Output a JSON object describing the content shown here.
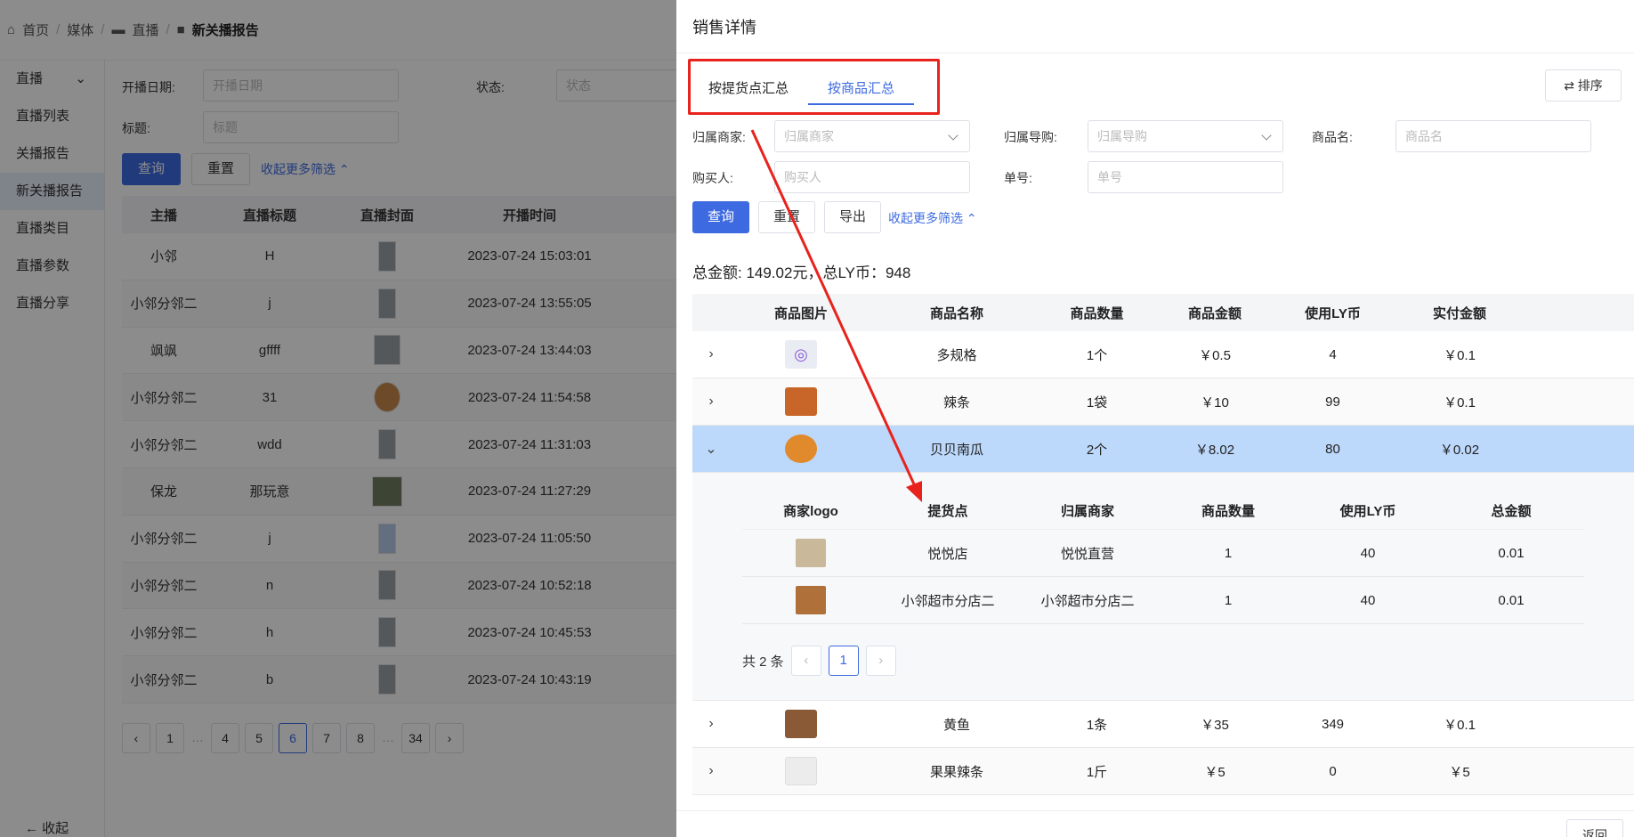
{
  "breadcrumb": {
    "home": "首页",
    "media": "媒体",
    "live": "直播",
    "current": "新关播报告",
    "sep": "/"
  },
  "sidebar": {
    "group": "直播",
    "items": [
      "直播列表",
      "关播报告",
      "新关播报告",
      "直播类目",
      "直播参数",
      "直播分享"
    ],
    "collapse": "收起"
  },
  "bg_filter": {
    "date_label": "开播日期:",
    "date_placeholder": "开播日期",
    "status_label": "状态:",
    "status_placeholder": "状态",
    "title_label": "标题:",
    "title_placeholder": "标题",
    "query": "查询",
    "reset": "重置",
    "fold": "收起更多筛选"
  },
  "bg_table": {
    "headers": [
      "主播",
      "直播标题",
      "直播封面",
      "开播时间"
    ],
    "rows": [
      {
        "host": "小邻",
        "title": "H",
        "time": "2023-07-24 15:03:01"
      },
      {
        "host": "小邻分邻二",
        "title": "j",
        "time": "2023-07-24 13:55:05"
      },
      {
        "host": "飒飒",
        "title": "gffff",
        "time": "2023-07-24 13:44:03"
      },
      {
        "host": "小邻分邻二",
        "title": "31",
        "time": "2023-07-24 11:54:58"
      },
      {
        "host": "小邻分邻二",
        "title": "wdd",
        "time": "2023-07-24 11:31:03"
      },
      {
        "host": "保龙",
        "title": "那玩意",
        "time": "2023-07-24 11:27:29"
      },
      {
        "host": "小邻分邻二",
        "title": "j",
        "time": "2023-07-24 11:05:50"
      },
      {
        "host": "小邻分邻二",
        "title": "n",
        "time": "2023-07-24 10:52:18"
      },
      {
        "host": "小邻分邻二",
        "title": "h",
        "time": "2023-07-24 10:45:53"
      },
      {
        "host": "小邻分邻二",
        "title": "b",
        "time": "2023-07-24 10:43:19"
      }
    ]
  },
  "bg_pager": {
    "prev": "‹",
    "next": "›",
    "pages": [
      "1",
      "…",
      "4",
      "5",
      "6",
      "7",
      "8",
      "…",
      "34"
    ],
    "current": "6"
  },
  "drawer": {
    "title": "销售详情",
    "tabs": [
      "按提货点汇总",
      "按商品汇总"
    ],
    "active_tab": 1,
    "sort": "⇄ 排序",
    "filters": {
      "merchant_label": "归属商家:",
      "merchant_ph": "归属商家",
      "guide_label": "归属导购:",
      "guide_ph": "归属导购",
      "product_label": "商品名:",
      "product_ph": "商品名",
      "buyer_label": "购买人:",
      "buyer_ph": "购买人",
      "order_label": "单号:",
      "order_ph": "单号"
    },
    "buttons": {
      "query": "查询",
      "reset": "重置",
      "export": "导出",
      "fold": "收起更多筛选"
    },
    "total": "总金额: 149.02元，总LY币：948",
    "headers": [
      "商品图片",
      "商品名称",
      "商品数量",
      "商品金额",
      "使用LY币",
      "实付金额"
    ],
    "rows": [
      {
        "name": "多规格",
        "qty": "1个",
        "amount": "￥0.5",
        "ly": "4",
        "paid": "￥0.1",
        "color": "#e9ecf2"
      },
      {
        "name": "辣条",
        "qty": "1袋",
        "amount": "￥10",
        "ly": "99",
        "paid": "￥0.1",
        "color": "#c8662a"
      },
      {
        "name": "贝贝南瓜",
        "qty": "2个",
        "amount": "￥8.02",
        "ly": "80",
        "paid": "￥0.02",
        "color": "#e08a2b"
      },
      {
        "name": "黄鱼",
        "qty": "1条",
        "amount": "￥35",
        "ly": "349",
        "paid": "￥0.1",
        "color": "#8a5a36"
      },
      {
        "name": "果果辣条",
        "qty": "1斤",
        "amount": "￥5",
        "ly": "0",
        "paid": "￥5",
        "color": "#e6e6e6"
      }
    ],
    "sub": {
      "headers": [
        "商家logo",
        "提货点",
        "归属商家",
        "商品数量",
        "使用LY币",
        "总金额"
      ],
      "rows": [
        {
          "point": "悦悦店",
          "merchant": "悦悦直营",
          "qty": "1",
          "ly": "40",
          "total": "0.01",
          "color": "#c9b89a"
        },
        {
          "point": "小邻超市分店二",
          "merchant": "小邻超市分店二",
          "qty": "1",
          "ly": "40",
          "total": "0.01",
          "color": "#b0703a"
        }
      ],
      "count": "共 2 条",
      "page": "1",
      "prev": "‹",
      "next": "›"
    },
    "back": "返回"
  }
}
